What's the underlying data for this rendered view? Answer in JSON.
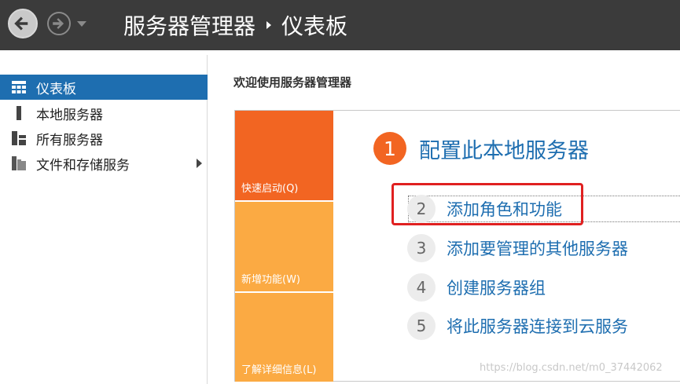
{
  "titlebar": {
    "back_icon": "back-arrow-icon",
    "forward_icon": "forward-arrow-icon",
    "breadcrumb": [
      "服务器管理器",
      "仪表板"
    ]
  },
  "sidebar": {
    "items": [
      {
        "label": "仪表板",
        "icon": "dashboard-icon",
        "active": true
      },
      {
        "label": "本地服务器",
        "icon": "server-icon",
        "active": false
      },
      {
        "label": "所有服务器",
        "icon": "servers-icon",
        "active": false
      },
      {
        "label": "文件和存储服务",
        "icon": "storage-icon",
        "active": false,
        "has_submenu": true
      }
    ]
  },
  "main": {
    "welcome_title": "欢迎使用服务器管理器",
    "tiles": [
      "快速启动(Q)",
      "新增功能(W)",
      "了解详细信息(L)"
    ],
    "steps": [
      {
        "num": "1",
        "label": "配置此本地服务器"
      },
      {
        "num": "2",
        "label": "添加角色和功能"
      },
      {
        "num": "3",
        "label": "添加要管理的其他服务器"
      },
      {
        "num": "4",
        "label": "创建服务器组"
      },
      {
        "num": "5",
        "label": "将此服务器连接到云服务"
      }
    ]
  },
  "watermark": "https://blog.csdn.net/m0_37442062",
  "colors": {
    "titlebar": "#3b3b3b",
    "accent_blue": "#1e6eb0",
    "orange": "#f26522",
    "light_orange": "#fbaa43",
    "highlight_red": "#e02020"
  }
}
